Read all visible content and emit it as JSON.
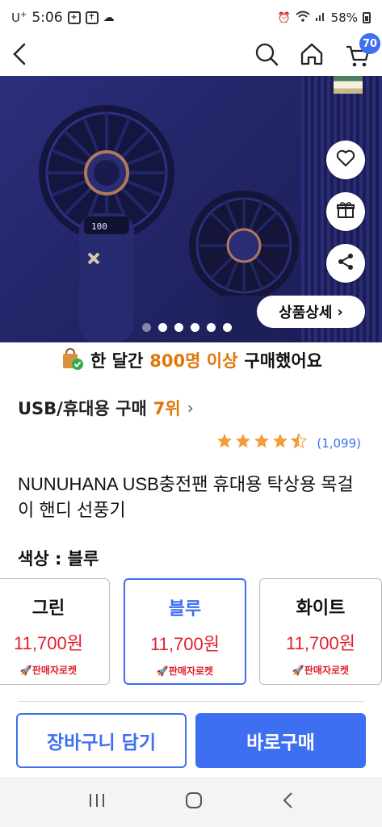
{
  "status_bar": {
    "carrier": "U",
    "carrier_sup": "+",
    "time": "5:06",
    "battery": "58%"
  },
  "nav": {
    "cart_count": "70"
  },
  "hero": {
    "detail_button": "상품상세",
    "slide_count": 6,
    "active_slide": 0
  },
  "buyers": {
    "prefix": "한 달간",
    "highlight": "800명 이상",
    "suffix": "구매했어요"
  },
  "rank": {
    "category": "USB/휴대용 구매",
    "position": "7위"
  },
  "rating": {
    "stars": 4.5,
    "count": "(1,099)"
  },
  "product": {
    "title": "NUNUHANA USB충전팬 휴대용 탁상용 목걸이 핸디 선풍기"
  },
  "color": {
    "label": "색상 : 블루"
  },
  "options": [
    {
      "name": "그린",
      "price": "11,700원",
      "tag": "판매자로켓"
    },
    {
      "name": "블루",
      "price": "11,700원",
      "tag": "판매자로켓"
    },
    {
      "name": "화이트",
      "price": "11,700원",
      "tag": "판매자로켓"
    }
  ],
  "actions": {
    "cart": "장바구니 담기",
    "buy": "바로구매"
  },
  "colors": {
    "accent": "#3d6ff0",
    "highlight": "#e0770a",
    "price": "#e0202c",
    "star": "#f29d38"
  }
}
